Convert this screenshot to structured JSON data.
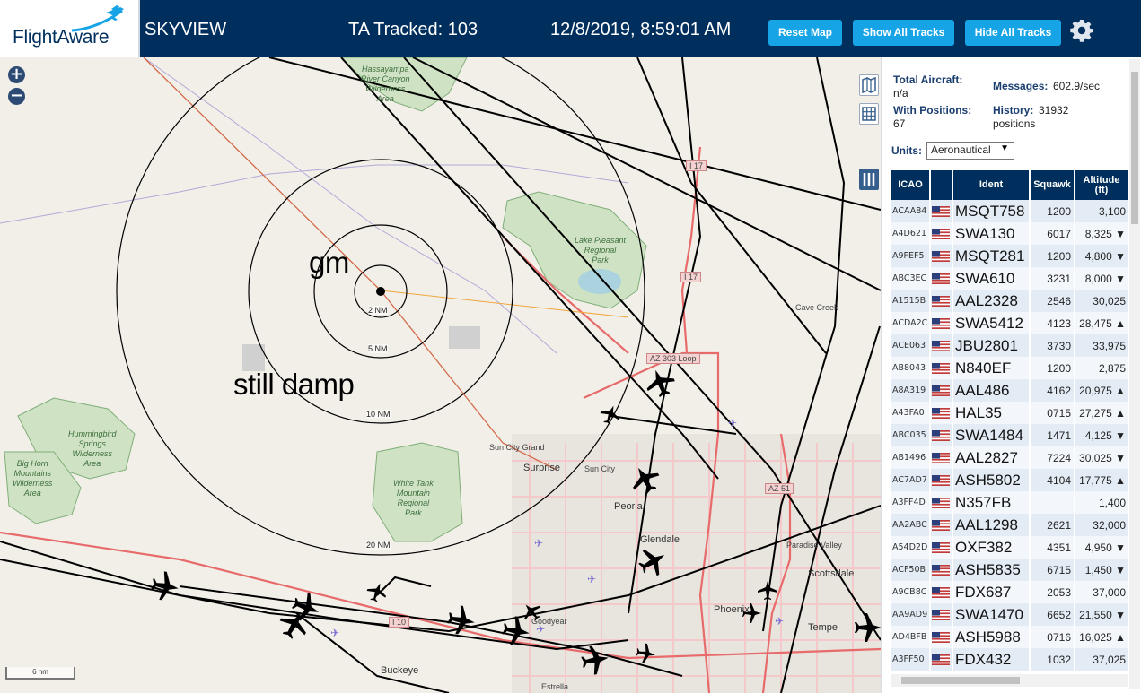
{
  "header": {
    "logo_text": "FlightAware",
    "app_title": "SKYVIEW",
    "tracked": "TA Tracked: 103",
    "datetime": "12/8/2019, 8:59:01 AM",
    "reset_map": "Reset Map",
    "show_all": "Show All Tracks",
    "hide_all": "Hide All Tracks",
    "accent_color": "#17a4e6",
    "bar_color": "#002f5d"
  },
  "map": {
    "zoom_in": "+",
    "zoom_out": "−",
    "info": "i",
    "scale": "6 nm",
    "annotations": {
      "gm": "gm",
      "still_damp": "still damp"
    },
    "range_rings": [
      "2 NM",
      "5 NM",
      "10 NM",
      "20 NM"
    ],
    "places": {
      "hassayampa": "Hassayampa\nRiver Canyon\nWilderness\nArea",
      "lake_pleasant": "Lake Pleasant\nRegional\nPark",
      "hummingbird": "Hummingbird\nSprings\nWilderness\nArea",
      "big_horn": "Big Horn\nMountains\nWilderness\nArea",
      "white_tank": "White Tank\nMountain\nRegional\nPark"
    },
    "cities": {
      "surprise": "Surprise",
      "sun_city": "Sun City",
      "sun_city_grand": "Sun City Grand",
      "peoria": "Peoria",
      "glendale": "Glendale",
      "phoenix": "Phoenix",
      "scottsdale": "Scottsdale",
      "tempe": "Tempe",
      "paradise_valley": "Paradise Valley",
      "cave_creek": "Cave Creek",
      "buckeye": "Buckeye",
      "goodyear": "Goodyear",
      "estrella": "Estrella"
    },
    "roads": {
      "i17a": "I 17",
      "i17b": "I 17",
      "loop303": "AZ 303 Loop",
      "az51": "AZ 51",
      "i10": "I 10"
    }
  },
  "panel": {
    "total_aircraft_label": "Total Aircraft:",
    "total_aircraft_value": "n/a",
    "with_positions_label": "With Positions:",
    "with_positions_value": "67",
    "messages_label": "Messages:",
    "messages_value": "602.9/sec",
    "history_label": "History:",
    "history_value": "31932",
    "history_unit": "positions",
    "units_label": "Units:",
    "units_value": "Aeronautical",
    "columns": [
      "ICAO",
      "",
      "Ident",
      "Squawk",
      "Altitude (ft)"
    ],
    "rows": [
      {
        "icao": "ACAA84",
        "ident": "MSQT758",
        "squawk": "1200",
        "alt": "3,100",
        "trend": ""
      },
      {
        "icao": "A4D621",
        "ident": "SWA130",
        "squawk": "6017",
        "alt": "8,325",
        "trend": "▼"
      },
      {
        "icao": "A9FEF5",
        "ident": "MSQT281",
        "squawk": "1200",
        "alt": "4,800",
        "trend": "▼"
      },
      {
        "icao": "ABC3EC",
        "ident": "SWA610",
        "squawk": "3231",
        "alt": "8,000",
        "trend": "▼"
      },
      {
        "icao": "A1515B",
        "ident": "AAL2328",
        "squawk": "2546",
        "alt": "30,025",
        "trend": ""
      },
      {
        "icao": "ACDA2C",
        "ident": "SWA5412",
        "squawk": "4123",
        "alt": "28,475",
        "trend": "▲"
      },
      {
        "icao": "ACE063",
        "ident": "JBU2801",
        "squawk": "3730",
        "alt": "33,975",
        "trend": ""
      },
      {
        "icao": "AB8043",
        "ident": "N840EF",
        "squawk": "1200",
        "alt": "2,875",
        "trend": ""
      },
      {
        "icao": "A8A319",
        "ident": "AAL486",
        "squawk": "4162",
        "alt": "20,975",
        "trend": "▲"
      },
      {
        "icao": "A43FA0",
        "ident": "HAL35",
        "squawk": "0715",
        "alt": "27,275",
        "trend": "▲"
      },
      {
        "icao": "ABC035",
        "ident": "SWA1484",
        "squawk": "1471",
        "alt": "4,125",
        "trend": "▼"
      },
      {
        "icao": "AB1496",
        "ident": "AAL2827",
        "squawk": "7224",
        "alt": "30,025",
        "trend": "▼"
      },
      {
        "icao": "AC7AD7",
        "ident": "ASH5802",
        "squawk": "4104",
        "alt": "17,775",
        "trend": "▲"
      },
      {
        "icao": "A3FF4D",
        "ident": "N357FB",
        "squawk": "",
        "alt": "1,400",
        "trend": ""
      },
      {
        "icao": "AA2ABC",
        "ident": "AAL1298",
        "squawk": "2621",
        "alt": "32,000",
        "trend": ""
      },
      {
        "icao": "A54D2D",
        "ident": "OXF382",
        "squawk": "4351",
        "alt": "4,950",
        "trend": "▼"
      },
      {
        "icao": "ACF50B",
        "ident": "ASH5835",
        "squawk": "6715",
        "alt": "1,450",
        "trend": "▼"
      },
      {
        "icao": "A9CB8C",
        "ident": "FDX687",
        "squawk": "2053",
        "alt": "37,000",
        "trend": ""
      },
      {
        "icao": "AA9AD9",
        "ident": "SWA1470",
        "squawk": "6652",
        "alt": "21,550",
        "trend": "▼"
      },
      {
        "icao": "AD4BFB",
        "ident": "ASH5988",
        "squawk": "0716",
        "alt": "16,025",
        "trend": "▲"
      },
      {
        "icao": "A3FF50",
        "ident": "FDX432",
        "squawk": "1032",
        "alt": "37,025",
        "trend": ""
      }
    ]
  }
}
